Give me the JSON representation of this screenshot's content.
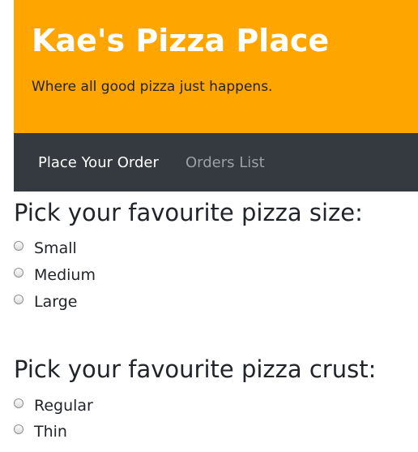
{
  "header": {
    "title": "Kae's Pizza Place",
    "tagline": "Where all good pizza just happens."
  },
  "nav": {
    "items": [
      {
        "label": "Place Your Order",
        "active": true
      },
      {
        "label": "Orders List",
        "active": false
      }
    ]
  },
  "size_section": {
    "heading": "Pick your favourite pizza size:",
    "options": [
      "Small",
      "Medium",
      "Large"
    ]
  },
  "crust_section": {
    "heading": "Pick your favourite pizza crust:",
    "options": [
      "Regular",
      "Thin"
    ]
  },
  "colors": {
    "header_bg": "#ffa500",
    "nav_bg": "#343a40"
  }
}
